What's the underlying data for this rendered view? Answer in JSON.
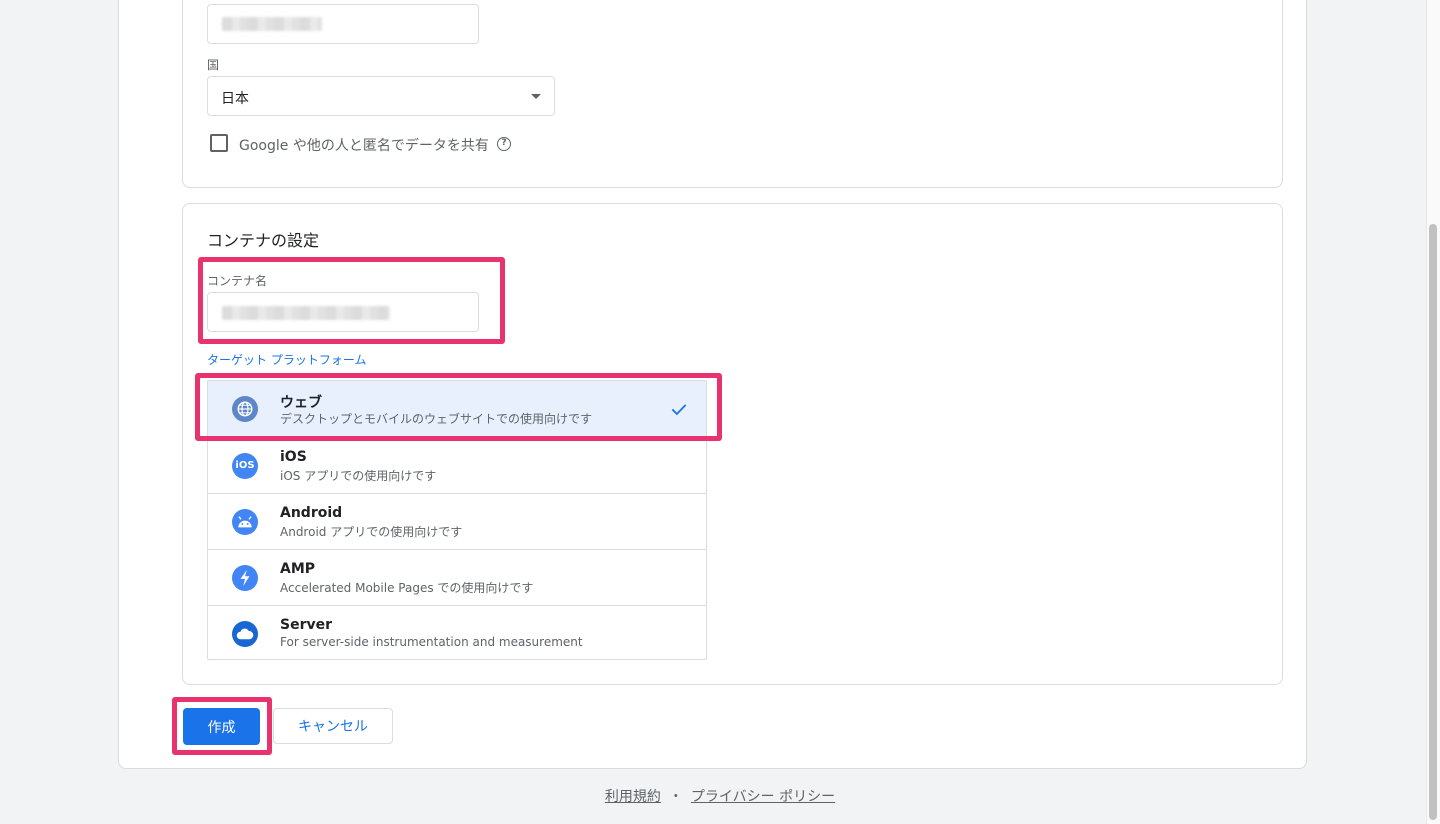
{
  "account": {
    "country_label": "国",
    "country_value": "日本",
    "share_label": "Google や他の人と匿名でデータを共有"
  },
  "container": {
    "section_title": "コンテナの設定",
    "name_label": "コンテナ名",
    "target_label": "ターゲット プラットフォーム",
    "platforms": [
      {
        "title": "ウェブ",
        "desc": "デスクトップとモバイルのウェブサイトでの使用向けです",
        "selected": true,
        "icon": "globe-icon"
      },
      {
        "title": "iOS",
        "desc": "iOS アプリでの使用向けです",
        "selected": false,
        "icon": "ios-icon"
      },
      {
        "title": "Android",
        "desc": "Android アプリでの使用向けです",
        "selected": false,
        "icon": "android-icon"
      },
      {
        "title": "AMP",
        "desc": "Accelerated Mobile Pages での使用向けです",
        "selected": false,
        "icon": "amp-bolt-icon"
      },
      {
        "title": "Server",
        "desc": "For server-side instrumentation and measurement",
        "selected": false,
        "icon": "cloud-icon"
      }
    ]
  },
  "actions": {
    "create_label": "作成",
    "cancel_label": "キャンセル"
  },
  "footer": {
    "terms": "利用規約",
    "separator": "・",
    "privacy": "プライバシー ポリシー"
  },
  "colors": {
    "accent": "#1a73e8",
    "highlight": "#e8336f",
    "selected_bg": "#e8f0fe"
  }
}
